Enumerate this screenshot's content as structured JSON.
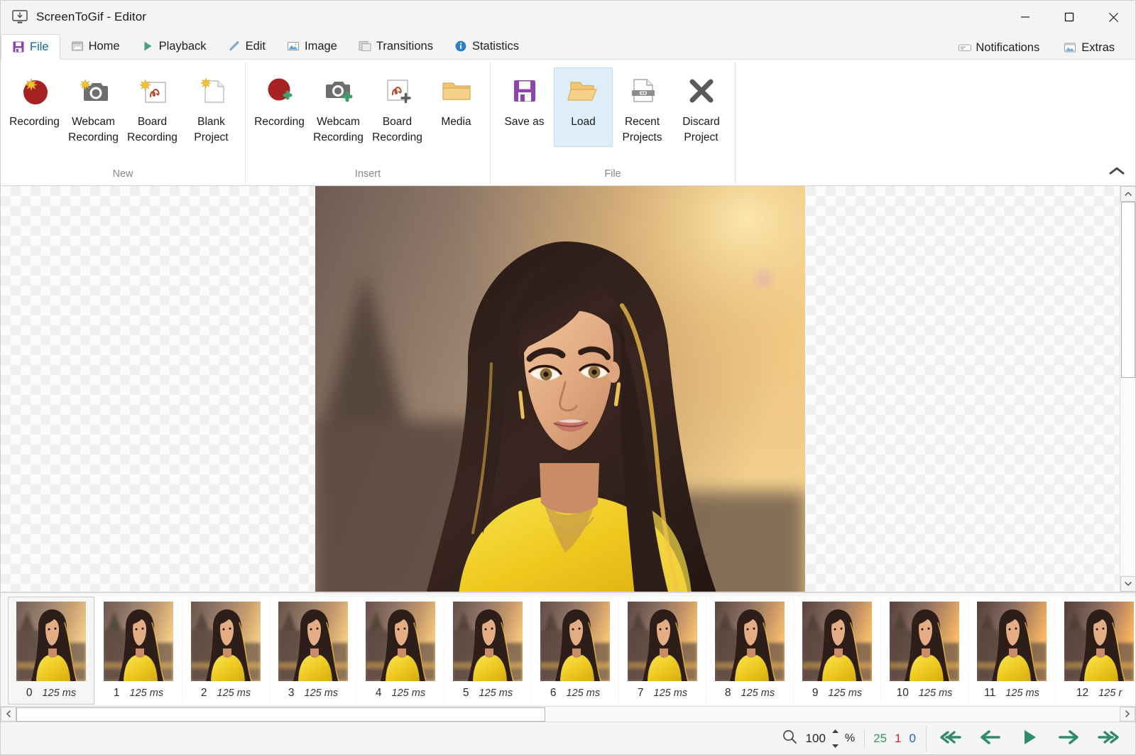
{
  "window": {
    "title": "ScreenToGif - Editor",
    "app_icon": "screen-recorder-icon",
    "minimize": "—",
    "maximize": "□",
    "close": "✕"
  },
  "ribbon_tabs": [
    {
      "id": "file",
      "label": "File",
      "icon": "floppy-disk-icon",
      "active": true
    },
    {
      "id": "home",
      "label": "Home",
      "icon": "home-window-icon",
      "active": false
    },
    {
      "id": "playback",
      "label": "Playback",
      "icon": "play-triangle-icon",
      "active": false
    },
    {
      "id": "edit",
      "label": "Edit",
      "icon": "pencil-icon",
      "active": false
    },
    {
      "id": "image",
      "label": "Image",
      "icon": "picture-icon",
      "active": false
    },
    {
      "id": "transitions",
      "label": "Transitions",
      "icon": "squares-icon",
      "active": false
    },
    {
      "id": "statistics",
      "label": "Statistics",
      "icon": "info-circle-icon",
      "active": false
    }
  ],
  "ribbon_tabs_right": [
    {
      "id": "notifications",
      "label": "Notifications",
      "icon": "notification-bar-icon"
    },
    {
      "id": "extras",
      "label": "Extras",
      "icon": "picture-icon"
    }
  ],
  "ribbon_groups": [
    {
      "id": "new",
      "label": "New",
      "buttons": [
        {
          "id": "new-recording",
          "label": "Recording",
          "icon": "record-star-icon",
          "selected": false
        },
        {
          "id": "new-webcam-recording",
          "label": "Webcam\nRecording",
          "icon": "webcam-star-icon",
          "selected": false
        },
        {
          "id": "new-board-recording",
          "label": "Board\nRecording",
          "icon": "board-star-icon",
          "selected": false
        },
        {
          "id": "new-blank-project",
          "label": "Blank\nProject",
          "icon": "page-star-icon",
          "selected": false
        }
      ]
    },
    {
      "id": "insert",
      "label": "Insert",
      "buttons": [
        {
          "id": "insert-recording",
          "label": "Recording",
          "icon": "record-plus-icon",
          "selected": false
        },
        {
          "id": "insert-webcam-recording",
          "label": "Webcam\nRecording",
          "icon": "webcam-plus-icon",
          "selected": false
        },
        {
          "id": "insert-board-recording",
          "label": "Board\nRecording",
          "icon": "board-plus-icon",
          "selected": false
        },
        {
          "id": "insert-media",
          "label": "Media",
          "icon": "folder-icon",
          "selected": false
        }
      ]
    },
    {
      "id": "file",
      "label": "File",
      "buttons": [
        {
          "id": "save-as",
          "label": "Save as",
          "icon": "floppy-disk-icon",
          "selected": false
        },
        {
          "id": "load",
          "label": "Load",
          "icon": "open-folder-icon",
          "selected": true
        },
        {
          "id": "recent-projects",
          "label": "Recent\nProjects",
          "icon": "recent-page-icon",
          "selected": false
        },
        {
          "id": "discard-project",
          "label": "Discard\nProject",
          "icon": "x-cross-icon",
          "selected": false
        }
      ]
    }
  ],
  "ribbon_collapse": {
    "id": "collapse-ribbon",
    "icon": "chevron-up-icon"
  },
  "preview": {
    "frame_alt": "stylized-illustration-woman-yellow-top-sunset",
    "vertical_scrollbar": {
      "up": "chevron-up-icon",
      "down": "chevron-down-icon"
    }
  },
  "frames": [
    {
      "index": "0",
      "delay": "125 ms",
      "selected": true
    },
    {
      "index": "1",
      "delay": "125 ms",
      "selected": false
    },
    {
      "index": "2",
      "delay": "125 ms",
      "selected": false
    },
    {
      "index": "3",
      "delay": "125 ms",
      "selected": false
    },
    {
      "index": "4",
      "delay": "125 ms",
      "selected": false
    },
    {
      "index": "5",
      "delay": "125 ms",
      "selected": false
    },
    {
      "index": "6",
      "delay": "125 ms",
      "selected": false
    },
    {
      "index": "7",
      "delay": "125 ms",
      "selected": false
    },
    {
      "index": "8",
      "delay": "125 ms",
      "selected": false
    },
    {
      "index": "9",
      "delay": "125 ms",
      "selected": false
    },
    {
      "index": "10",
      "delay": "125 ms",
      "selected": false
    },
    {
      "index": "11",
      "delay": "125 ms",
      "selected": false
    },
    {
      "index": "12",
      "delay": "125 r",
      "selected": false
    }
  ],
  "horizontal_scrollbar": {
    "left": "chevron-left-icon",
    "right": "chevron-right-icon"
  },
  "statusbar": {
    "zoom_icon": "magnifier-icon",
    "zoom_value": "100",
    "percent_symbol": "%",
    "spinner_up": "spinner-up-icon",
    "spinner_down": "spinner-down-icon",
    "total_frames": "25",
    "selected_frames": "1",
    "current_frame": "0",
    "nav": [
      {
        "id": "first-frame",
        "icon": "double-arrow-left-icon"
      },
      {
        "id": "previous-frame",
        "icon": "arrow-left-icon"
      },
      {
        "id": "play",
        "icon": "play-triangle-icon"
      },
      {
        "id": "next-frame",
        "icon": "arrow-right-icon"
      },
      {
        "id": "last-frame",
        "icon": "double-arrow-right-icon"
      }
    ]
  },
  "colors": {
    "accent_green": "#2e9b57",
    "accent_red": "#d62b1f",
    "accent_blue": "#1a5fd4",
    "tab_active_text": "#1064a8",
    "selection_bg": "#ddeefa"
  }
}
